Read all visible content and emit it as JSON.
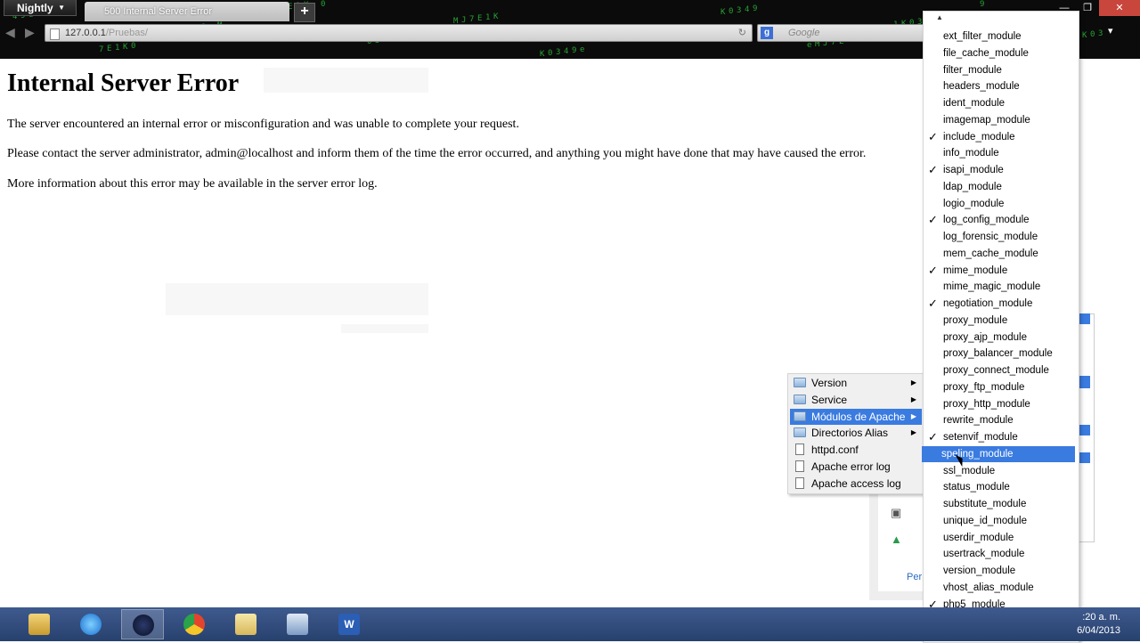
{
  "browser": {
    "menu_label": "Nightly",
    "tab_title": "500 Internal Server Error",
    "new_tab": "+",
    "url_host": "127.0.0.1",
    "url_path": "/Pruebas/",
    "search_engine_badge": "g",
    "search_placeholder": "Google"
  },
  "page": {
    "title": "Internal Server Error",
    "p1": "The server encountered an internal error or misconfiguration and was unable to complete your request.",
    "p2": "Please contact the server administrator, admin@localhost and inform them of the time the error occurred, and anything you might have done that may have caused the error.",
    "p3": "More information about this error may be available in the server error log."
  },
  "context_menu": {
    "items": [
      {
        "label": "Version",
        "icon": "folder-icon",
        "submenu": true
      },
      {
        "label": "Service",
        "icon": "folder-icon",
        "submenu": true
      },
      {
        "label": "Módulos de Apache",
        "icon": "folder-icon",
        "submenu": true,
        "highlighted": true
      },
      {
        "label": "Directorios Alias",
        "icon": "folder-icon",
        "submenu": true
      },
      {
        "label": "httpd.conf",
        "icon": "file-icon"
      },
      {
        "label": "Apache error log",
        "icon": "file-icon"
      },
      {
        "label": "Apache access log",
        "icon": "file-icon"
      }
    ]
  },
  "modules": {
    "items": [
      {
        "label": "ext_filter_module",
        "checked": false
      },
      {
        "label": "file_cache_module",
        "checked": false
      },
      {
        "label": "filter_module",
        "checked": false
      },
      {
        "label": "headers_module",
        "checked": false
      },
      {
        "label": "ident_module",
        "checked": false
      },
      {
        "label": "imagemap_module",
        "checked": false
      },
      {
        "label": "include_module",
        "checked": true
      },
      {
        "label": "info_module",
        "checked": false
      },
      {
        "label": "isapi_module",
        "checked": true
      },
      {
        "label": "ldap_module",
        "checked": false
      },
      {
        "label": "logio_module",
        "checked": false
      },
      {
        "label": "log_config_module",
        "checked": true
      },
      {
        "label": "log_forensic_module",
        "checked": false
      },
      {
        "label": "mem_cache_module",
        "checked": false
      },
      {
        "label": "mime_module",
        "checked": true
      },
      {
        "label": "mime_magic_module",
        "checked": false
      },
      {
        "label": "negotiation_module",
        "checked": true
      },
      {
        "label": "proxy_module",
        "checked": false
      },
      {
        "label": "proxy_ajp_module",
        "checked": false
      },
      {
        "label": "proxy_balancer_module",
        "checked": false
      },
      {
        "label": "proxy_connect_module",
        "checked": false
      },
      {
        "label": "proxy_ftp_module",
        "checked": false
      },
      {
        "label": "proxy_http_module",
        "checked": false
      },
      {
        "label": "rewrite_module",
        "checked": false
      },
      {
        "label": "setenvif_module",
        "checked": true
      },
      {
        "label": "speling_module",
        "checked": false,
        "highlighted": true
      },
      {
        "label": "ssl_module",
        "checked": false
      },
      {
        "label": "status_module",
        "checked": false
      },
      {
        "label": "substitute_module",
        "checked": false
      },
      {
        "label": "unique_id_module",
        "checked": false
      },
      {
        "label": "userdir_module",
        "checked": false
      },
      {
        "label": "usertrack_module",
        "checked": false
      },
      {
        "label": "version_module",
        "checked": false
      },
      {
        "label": "vhost_alias_module",
        "checked": false
      },
      {
        "label": "php5_module",
        "checked": true
      }
    ],
    "check_glyph": "✓"
  },
  "flyout": {
    "link_fragment": "Per"
  },
  "taskbar": {
    "apps": [
      "file-explorer-icon",
      "internet-explorer-icon",
      "firefox-nightly-icon",
      "chrome-icon",
      "folder-icon",
      "virtualbox-icon",
      "word-icon"
    ],
    "clock_time": ":20 a. m.",
    "clock_date": "6/04/2013"
  },
  "colors": {
    "highlight": "#3a7be0",
    "taskbar": "#2f4a7e"
  }
}
